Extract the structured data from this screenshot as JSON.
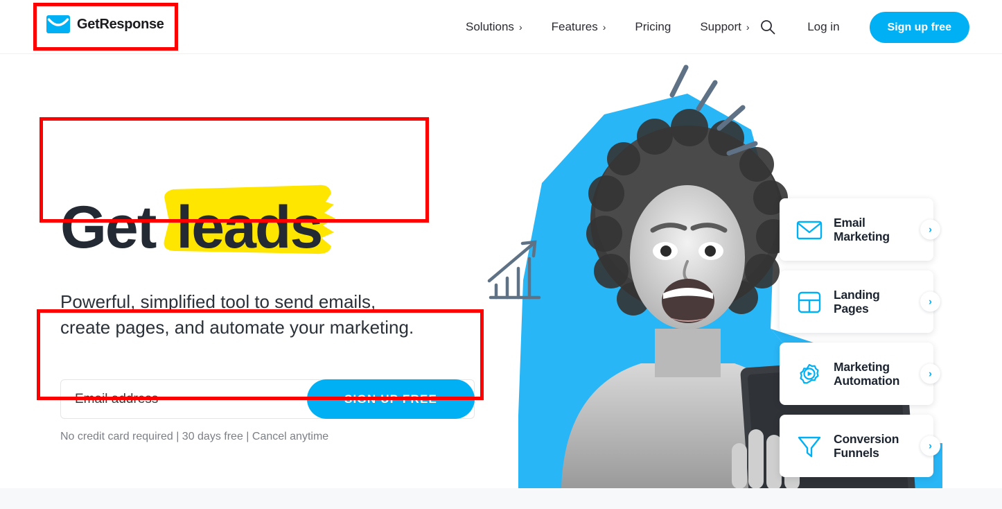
{
  "brand": {
    "name": "GetResponse",
    "accent_color": "#00b0f5",
    "highlight_color": "#ffe600",
    "annotation_color": "#fc0000"
  },
  "header": {
    "nav_items": [
      {
        "label": "Solutions",
        "chevron": "›",
        "icon": "chevron-right-icon"
      },
      {
        "label": "Features",
        "chevron": "›",
        "icon": "chevron-right-icon"
      },
      {
        "label": "Pricing",
        "chevron": "",
        "icon": ""
      },
      {
        "label": "Support",
        "chevron": "›",
        "icon": "chevron-right-icon"
      }
    ],
    "search_icon": "search-icon",
    "login_label": "Log in",
    "signup_label": "Sign up free"
  },
  "hero": {
    "headline_plain": "Get",
    "headline_highlight": "leads",
    "subheadline": "Powerful, simplified tool to send emails,\ncreate pages, and automate your marketing.",
    "form": {
      "email_placeholder": "Email address",
      "email_value": "",
      "cta_label": "SIGN UP FREE",
      "note": "No credit card required | 30 days free | Cancel anytime"
    }
  },
  "feature_cards": [
    {
      "label": "Email\nMarketing",
      "icon": "envelope-icon",
      "arrow": "›"
    },
    {
      "label": "Landing\nPages",
      "icon": "layout-grid-icon",
      "arrow": "›"
    },
    {
      "label": "Marketing\nAutomation",
      "icon": "gear-play-icon",
      "arrow": "›"
    },
    {
      "label": "Conversion\nFunnels",
      "icon": "funnel-icon",
      "arrow": "›"
    }
  ],
  "hero_art": {
    "description": "grayscale photo of smiling woman holding laptop on cyan polygon background",
    "doodles": [
      "bar-chart-arrow-doodle",
      "radiating-strokes-doodle"
    ]
  }
}
